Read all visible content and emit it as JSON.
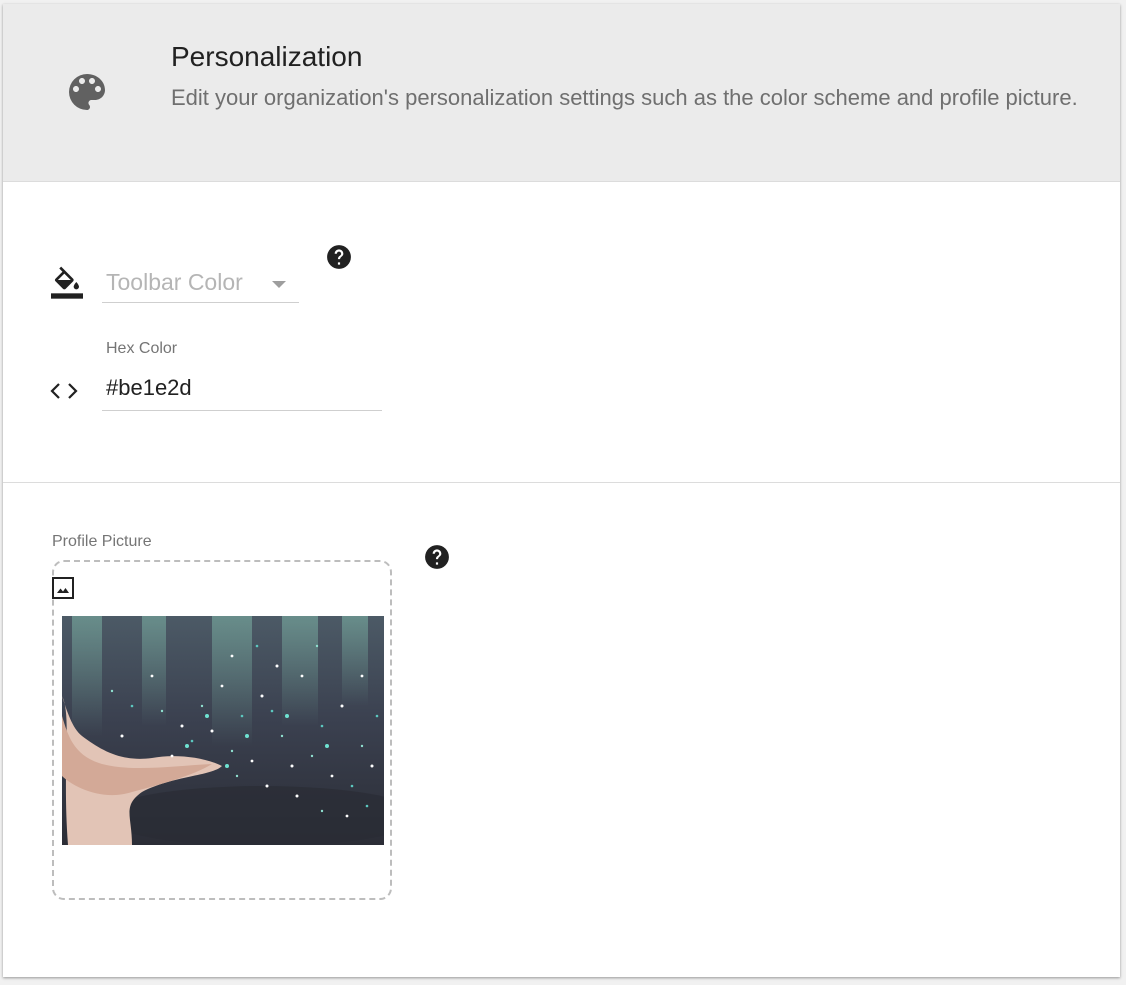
{
  "header": {
    "icon": "palette-icon",
    "title": "Personalization",
    "description": "Edit your organization's personalization settings such as the color scheme and profile picture."
  },
  "colors": {
    "toolbar_color": {
      "icon": "format-color-fill-icon",
      "placeholder": "Toolbar Color",
      "help_icon": "help-circle-icon"
    },
    "hex_color": {
      "icon": "code-brackets-icon",
      "label": "Hex Color",
      "value": "#be1e2d"
    }
  },
  "profile_picture": {
    "label": "Profile Picture",
    "icon": "image-icon",
    "help_icon": "help-circle-icon",
    "preview_image": "hands-blowing-glitter-photo"
  },
  "theme": {
    "header_bg": "#ebebeb",
    "icon_color": "#616161",
    "text_primary": "#212121",
    "text_secondary": "#6f6f6f"
  }
}
